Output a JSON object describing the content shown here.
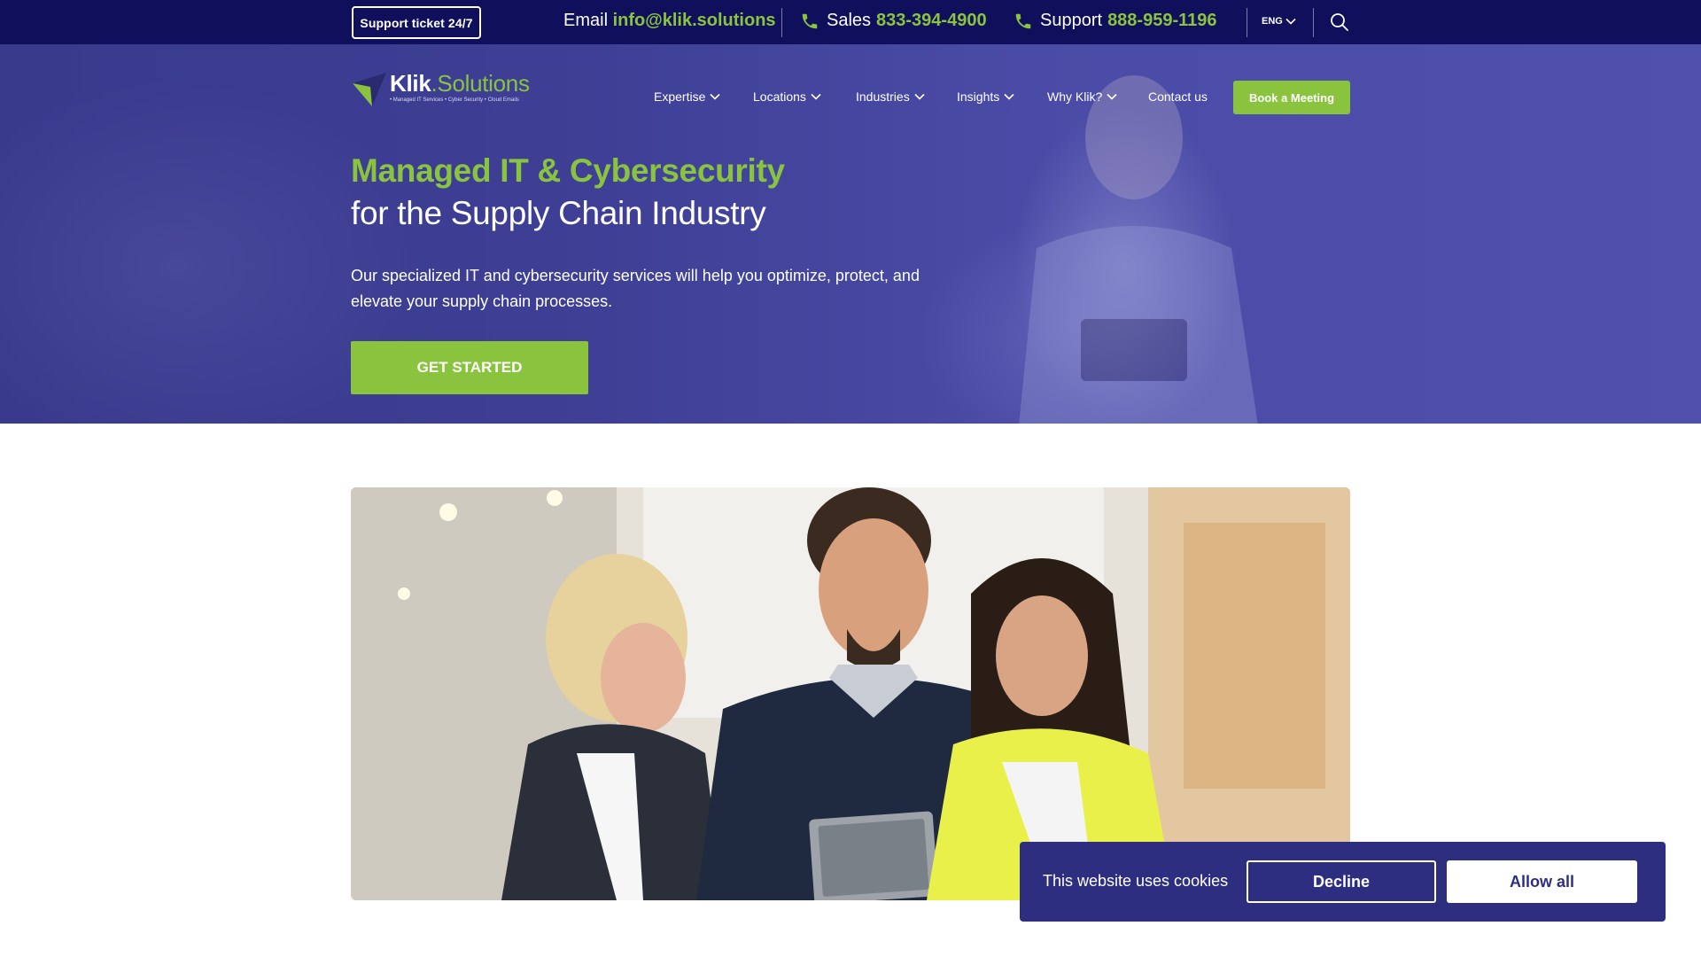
{
  "topbar": {
    "support_ticket_label": "Support ticket 24/7",
    "email_label": "Email",
    "email_value": "info@klik.solutions",
    "sales_label": "Sales",
    "sales_value": "833-394-4900",
    "support_label": "Support",
    "support_value": "888-959-1196",
    "language": "ENG",
    "icons": {
      "phone": "phone-icon",
      "search": "search-icon",
      "language_chevron": "chevron-down-icon"
    }
  },
  "logo": {
    "name_main": "Klik",
    "name_suffix": ".Solutions",
    "tagline": "• Managed IT Services • Cyber Security • Cloud Emails"
  },
  "nav": {
    "items": [
      {
        "label": "Expertise",
        "has_dropdown": true
      },
      {
        "label": "Locations",
        "has_dropdown": true
      },
      {
        "label": "Industries",
        "has_dropdown": true
      },
      {
        "label": "Insights",
        "has_dropdown": true
      },
      {
        "label": "Why Klik?",
        "has_dropdown": true
      },
      {
        "label": "Contact us",
        "has_dropdown": false
      }
    ],
    "cta_label": "Book a Meeting"
  },
  "hero": {
    "heading_line1": "Managed IT & Cybersecurity",
    "heading_line2": "for the Supply Chain Industry",
    "description": "Our specialized IT and cybersecurity services will help you optimize, protect, and elevate your supply chain processes.",
    "cta_label": "GET STARTED"
  },
  "cookie": {
    "text": "This website uses cookies",
    "decline_label": "Decline",
    "allow_label": "Allow all"
  },
  "colors": {
    "topbar_bg": "#0f0f5c",
    "brand_green": "#8ac43f",
    "hero_bg": "#3e3f95",
    "cookie_bg": "#2e2e80"
  }
}
